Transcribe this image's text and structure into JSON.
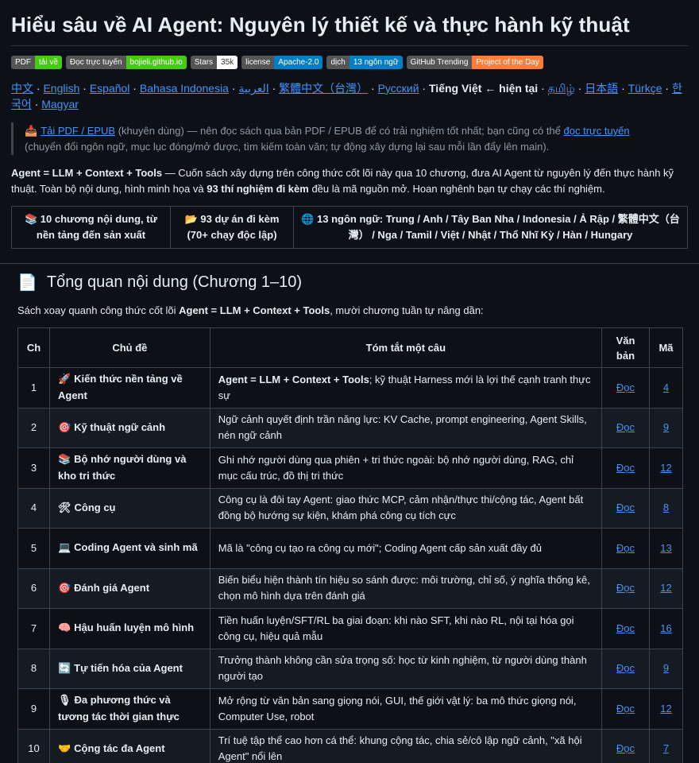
{
  "title": "Hiểu sâu về AI Agent: Nguyên lý thiết kế và thực hành kỹ thuật",
  "badges": [
    {
      "l": "PDF",
      "r": "tải về",
      "c": "#4c1"
    },
    {
      "l": "Đọc trực tuyến",
      "r": "bojieli.github.io",
      "c": "#4c1"
    },
    {
      "l": "Stars",
      "r": "35k",
      "c": "#fff"
    },
    {
      "l": "license",
      "r": "Apache-2.0",
      "c": "#007ec6"
    },
    {
      "l": "dịch",
      "r": "13 ngôn ngữ",
      "c": "#007ec6"
    },
    {
      "l": "GitHub Trending",
      "r": "Project of the Day",
      "c": "#fe7d37"
    }
  ],
  "languages": [
    {
      "t": "中文",
      "link": true
    },
    {
      "t": "English",
      "link": true
    },
    {
      "t": "Español",
      "link": true
    },
    {
      "t": "Bahasa Indonesia",
      "link": true
    },
    {
      "t": "العربية",
      "link": true
    },
    {
      "t": "繁體中文（台灣）",
      "link": true
    },
    {
      "t": "Русский",
      "link": true
    },
    {
      "t": "Tiếng Việt ← hiện tại",
      "link": false
    },
    {
      "t": "தமிழ்",
      "link": true
    },
    {
      "t": "日本語",
      "link": true
    },
    {
      "t": "Türkçe",
      "link": true
    },
    {
      "t": "한국어",
      "link": true
    },
    {
      "t": "Magyar",
      "link": true
    }
  ],
  "quote": {
    "link1": "Tải PDF / EPUB",
    "text1": " (khuyên dùng) — nên đọc sách qua bản PDF / EPUB để có trải nghiệm tốt nhất; bạn cũng có thể ",
    "link2": "đọc trực tuyến",
    "text2": "(chuyển đổi ngôn ngữ, mục lục đóng/mở được, tìm kiếm toàn văn; tự động xây dựng lại sau mỗi lần đẩy lên main)."
  },
  "intro": {
    "formula": "Agent = LLM + Context + Tools",
    "text1": " — Cuốn sách xây dựng trên công thức cốt lõi này qua 10 chương, đưa AI Agent từ nguyên lý đến thực hành kỹ thuật. Toàn bộ nội dung, hình minh họa và ",
    "bold2": "93 thí nghiệm đi kèm",
    "text2": " đều là mã nguồn mở. Hoan nghênh bạn tự chạy các thí nghiệm."
  },
  "features": [
    "📚 10 chương nội dung, từ nền tảng đến sản xuất",
    "📂 93 dự án đi kèm (70+ chạy độc lập)",
    "🌐 13 ngôn ngữ: Trung / Anh / Tây Ban Nha / Indonesia / Ả Rập / 繁體中文（台灣） / Nga / Tamil / Việt / Nhật / Thổ Nhĩ Kỳ / Hàn / Hungary"
  ],
  "section": {
    "icon": "📄",
    "title": "Tổng quan nội dung (Chương 1–10)",
    "sub_pre": "Sách xoay quanh công thức cốt lõi ",
    "sub_bold": "Agent = LLM + Context + Tools",
    "sub_post": ", mười chương tuần tự nâng dần:"
  },
  "table": {
    "headers": [
      "Ch",
      "Chủ đề",
      "Tóm tắt một câu",
      "Văn bản",
      "Mã"
    ],
    "rows": [
      {
        "ch": "1",
        "icon": "🚀",
        "topic": "Kiến thức nền tảng về Agent",
        "bold": "Agent = LLM + Context + Tools",
        "summary": "; kỹ thuật Harness mới là lợi thế cạnh tranh thực sự",
        "read": "Đọc",
        "code": "4"
      },
      {
        "ch": "2",
        "icon": "🎯",
        "topic": "Kỹ thuật ngữ cảnh",
        "bold": "",
        "summary": "Ngữ cảnh quyết định trần năng lực: KV Cache, prompt engineering, Agent Skills, nén ngữ cảnh",
        "read": "Đọc",
        "code": "9"
      },
      {
        "ch": "3",
        "icon": "📚",
        "topic": "Bộ nhớ người dùng và kho tri thức",
        "bold": "",
        "summary": "Ghi nhớ người dùng qua phiên + tri thức ngoài: bộ nhớ người dùng, RAG, chỉ mục cấu trúc, đồ thị tri thức",
        "read": "Đọc",
        "code": "12"
      },
      {
        "ch": "4",
        "icon": "🛠",
        "topic": "Công cụ",
        "bold": "",
        "summary": "Công cụ là đôi tay Agent: giao thức MCP, cảm nhận/thực thi/cộng tác, Agent bất đồng bộ hướng sự kiện, khám phá công cụ tích cực",
        "read": "Đọc",
        "code": "8"
      },
      {
        "ch": "5",
        "icon": "💻",
        "topic": "Coding Agent và sinh mã",
        "bold": "",
        "summary": "Mã là \"công cụ tạo ra công cụ mới\"; Coding Agent cấp sản xuất đầy đủ",
        "read": "Đọc",
        "code": "13"
      },
      {
        "ch": "6",
        "icon": "🎯",
        "topic": "Đánh giá Agent",
        "bold": "",
        "summary": "Biến biểu hiện thành tín hiệu so sánh được: môi trường, chỉ số, ý nghĩa thống kê, chọn mô hình dựa trên đánh giá",
        "read": "Đọc",
        "code": "12"
      },
      {
        "ch": "7",
        "icon": "🧠",
        "topic": "Hậu huấn luyện mô hình",
        "bold": "",
        "summary": "Tiền huấn luyện/SFT/RL ba giai đoạn: khi nào SFT, khi nào RL, nội tại hóa gọi công cụ, hiệu quả mẫu",
        "read": "Đọc",
        "code": "16"
      },
      {
        "ch": "8",
        "icon": "🔄",
        "topic": "Tự tiến hóa của Agent",
        "bold": "",
        "summary": "Trưởng thành không cần sửa trọng số: học từ kinh nghiệm, từ người dùng thành người tạo",
        "read": "Đọc",
        "code": "9"
      },
      {
        "ch": "9",
        "icon": "🎙",
        "topic": "Đa phương thức và tương tác thời gian thực",
        "bold": "",
        "summary": "Mở rộng từ văn bản sang giọng nói, GUI, thế giới vật lý: ba mô thức giọng nói, Computer Use, robot",
        "read": "Đọc",
        "code": "12"
      },
      {
        "ch": "10",
        "icon": "🤝",
        "topic": "Cộng tác đa Agent",
        "bold": "",
        "summary": "Trí tuệ tập thể cao hơn cá thể: khung cộng tác, chia sẻ/cô lập ngữ cảnh, \"xã hội Agent\" nổi lên",
        "read": "Đọc",
        "code": "7"
      }
    ]
  }
}
